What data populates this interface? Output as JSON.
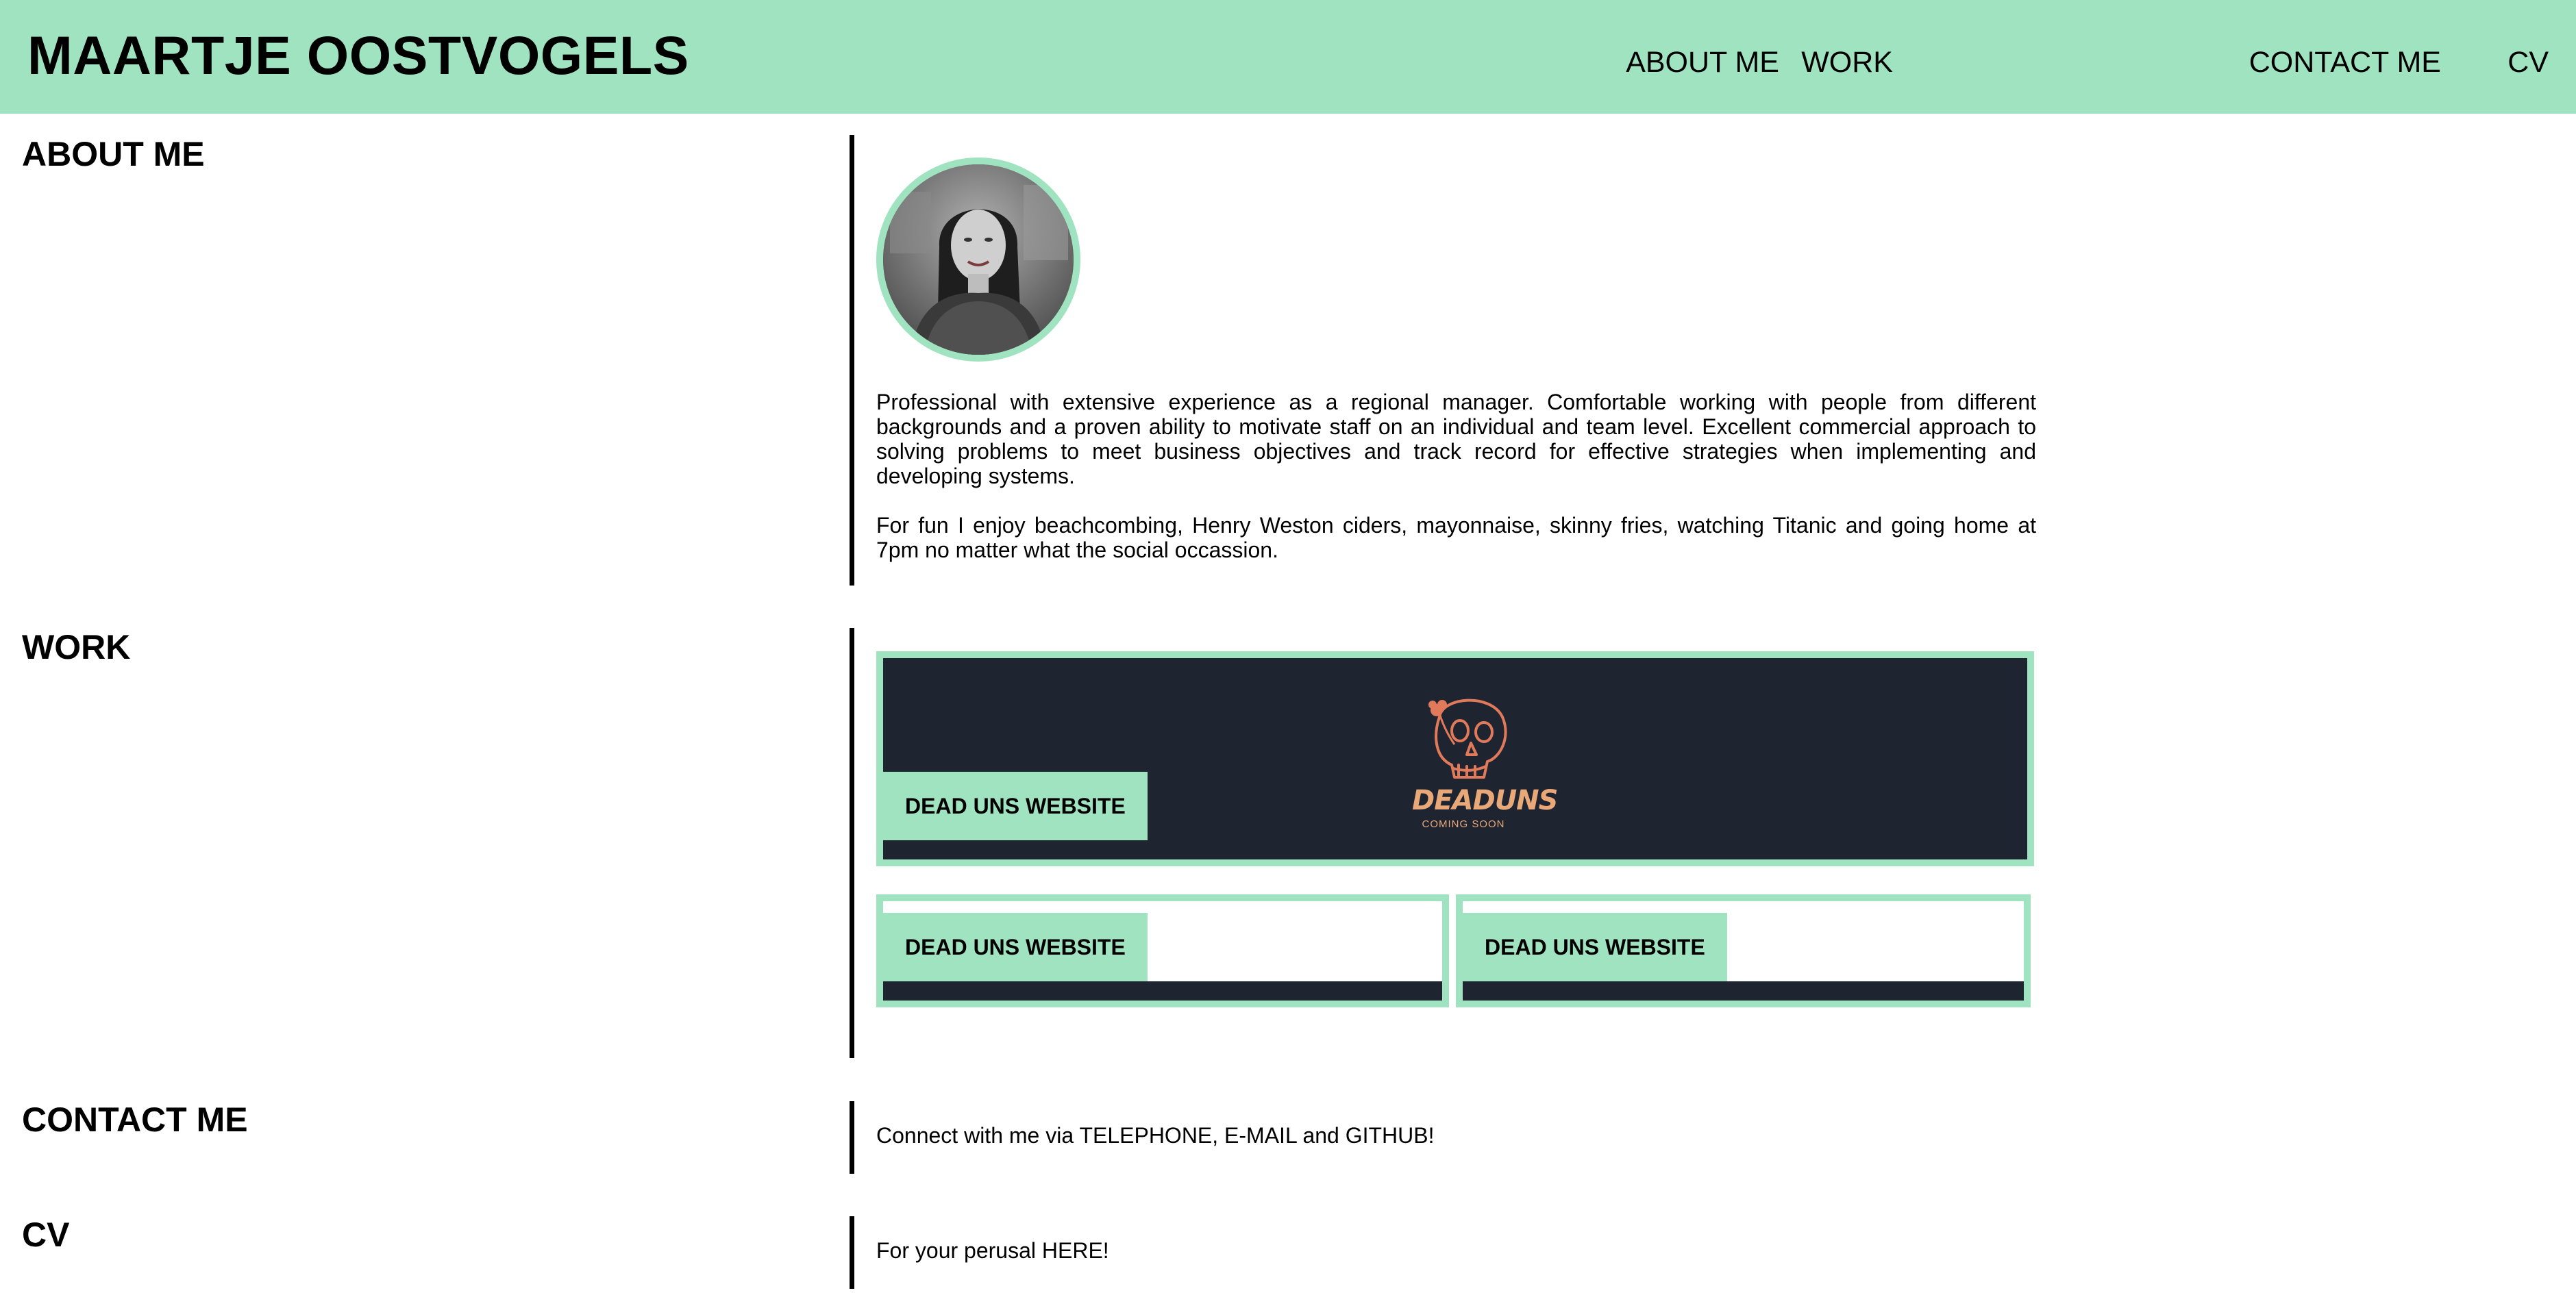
{
  "header": {
    "title": "MAARTJE OOSTVOGELS",
    "nav": [
      {
        "label": "ABOUT ME"
      },
      {
        "label": "WORK"
      },
      {
        "label": "CONTACT ME"
      },
      {
        "label": "CV"
      }
    ]
  },
  "about": {
    "heading": "ABOUT ME",
    "paragraph1": "Professional with extensive experience as a regional manager. Comfortable working with people from different backgrounds and a proven ability to motivate staff on an individual and team level. Excellent commercial approach to solving problems to meet business objectives and track record for effective strategies when implementing and developing systems.",
    "paragraph2": "For fun I enjoy beachcombing, Henry Weston ciders, mayonnaise, skinny fries, watching Titanic and going home at 7pm no matter what the social occassion."
  },
  "work": {
    "heading": "WORK",
    "projects": [
      {
        "label": "DEAD UNS WEBSITE",
        "logo_text": "DEADUNS",
        "logo_subtext": "COMING SOON"
      },
      {
        "label": "DEAD UNS WEBSITE"
      },
      {
        "label": "DEAD UNS WEBSITE"
      }
    ]
  },
  "contact": {
    "heading": "CONTACT ME",
    "prefix": "Connect with me via ",
    "telephone": "TELEPHONE",
    "sep1": ", ",
    "email": "E-MAIL",
    "sep2": " and ",
    "github": "GITHUB",
    "suffix": "!"
  },
  "cv": {
    "heading": "CV",
    "prefix": "For your perusal ",
    "link": "HERE",
    "suffix": "!"
  },
  "colors": {
    "accent": "#a0e3c1",
    "card_dark": "#1f2431",
    "logo": "#e07a5a",
    "rule": "#000000"
  },
  "icons": {
    "logo": "skull-icon"
  }
}
